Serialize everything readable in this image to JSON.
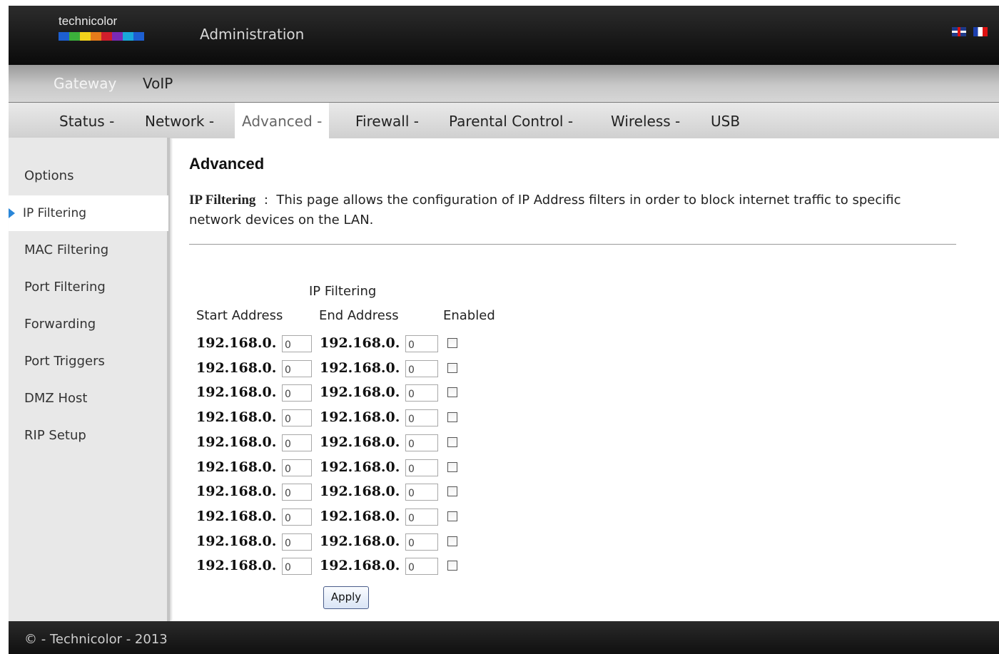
{
  "header": {
    "logo_text": "technicolor",
    "title": "Administration",
    "languages": [
      "English",
      "Français"
    ],
    "logo_colors": [
      "#1d5fd1",
      "#3bb03b",
      "#f2d21b",
      "#e67b1a",
      "#d11e2c",
      "#7a2ab6",
      "#19a7d9",
      "#1d5fd1"
    ]
  },
  "categories": [
    {
      "label": "Gateway"
    },
    {
      "label": "VoIP"
    }
  ],
  "tabs": [
    {
      "label": "Status -"
    },
    {
      "label": "Network -"
    },
    {
      "label": "Advanced -"
    },
    {
      "label": "Firewall -"
    },
    {
      "label": "Parental Control -"
    },
    {
      "label": "Wireless -"
    },
    {
      "label": "USB"
    }
  ],
  "active_tab": "Advanced -",
  "sidebar": {
    "items": [
      {
        "label": "Options"
      },
      {
        "label": "IP Filtering"
      },
      {
        "label": "MAC Filtering"
      },
      {
        "label": "Port Filtering"
      },
      {
        "label": "Forwarding"
      },
      {
        "label": "Port Triggers"
      },
      {
        "label": "DMZ Host"
      },
      {
        "label": "RIP Setup"
      }
    ],
    "active": "IP Filtering"
  },
  "main": {
    "title": "Advanced",
    "desc_label": "IP Filtering",
    "desc_sep": ":",
    "desc_text": "This page allows the configuration of IP Address filters in order to block internet traffic to specific network devices on the LAN.",
    "table_title": "IP Filtering",
    "col_start": "Start Address",
    "col_end": "End Address",
    "col_enabled": "Enabled",
    "ip_prefix": "192.168.0.",
    "rows": [
      {
        "start": "0",
        "end": "0",
        "enabled": false
      },
      {
        "start": "0",
        "end": "0",
        "enabled": false
      },
      {
        "start": "0",
        "end": "0",
        "enabled": false
      },
      {
        "start": "0",
        "end": "0",
        "enabled": false
      },
      {
        "start": "0",
        "end": "0",
        "enabled": false
      },
      {
        "start": "0",
        "end": "0",
        "enabled": false
      },
      {
        "start": "0",
        "end": "0",
        "enabled": false
      },
      {
        "start": "0",
        "end": "0",
        "enabled": false
      },
      {
        "start": "0",
        "end": "0",
        "enabled": false
      },
      {
        "start": "0",
        "end": "0",
        "enabled": false
      }
    ],
    "apply_label": "Apply"
  },
  "footer": {
    "text": "© - Technicolor - 2013"
  },
  "colors": {
    "accent": "#2a86d8"
  }
}
